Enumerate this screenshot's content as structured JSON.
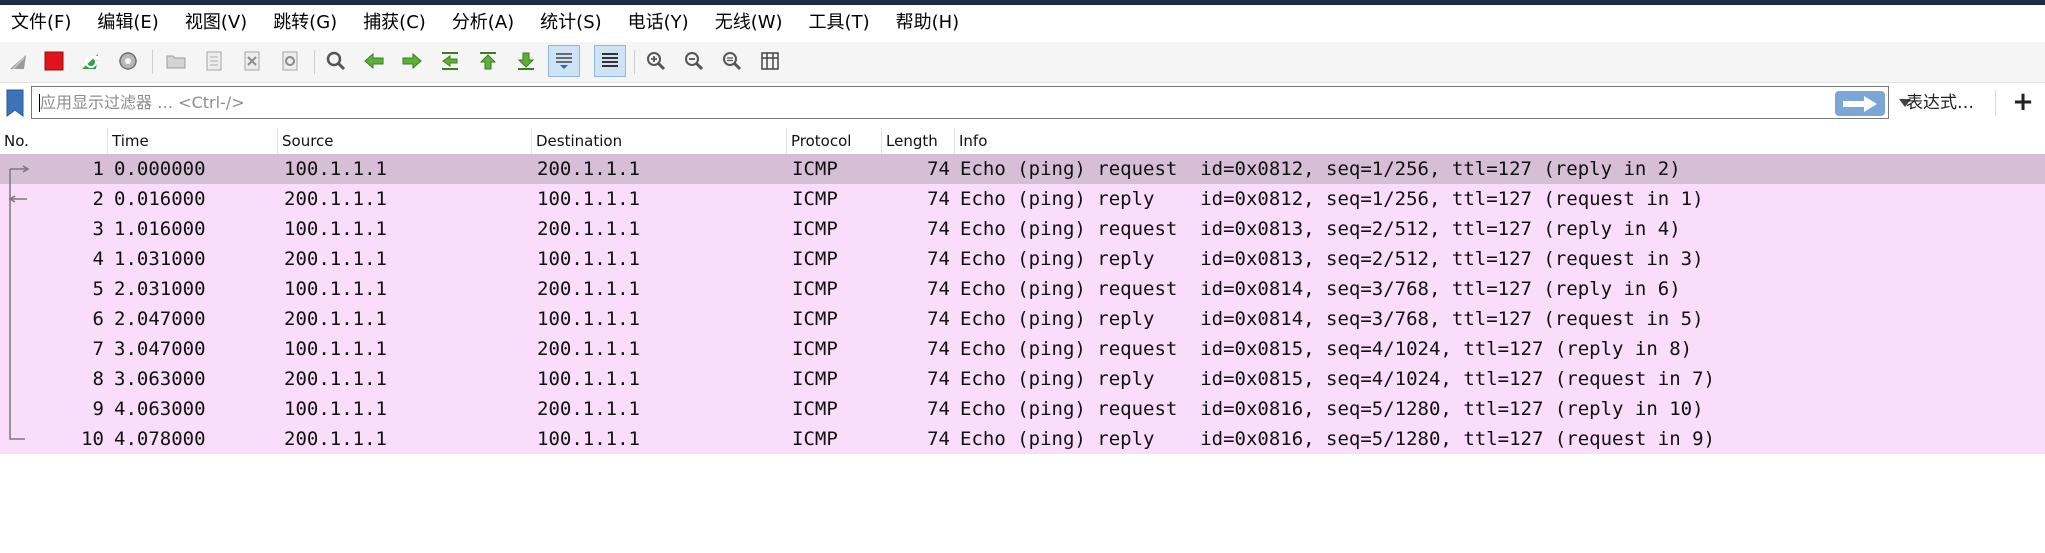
{
  "menu": [
    "文件(F)",
    "编辑(E)",
    "视图(V)",
    "跳转(G)",
    "捕获(C)",
    "分析(A)",
    "统计(S)",
    "电话(Y)",
    "无线(W)",
    "工具(T)",
    "帮助(H)"
  ],
  "toolbar": {
    "icons": [
      "shark-fin-start-icon",
      "stop-capture-icon",
      "restart-capture-icon",
      "capture-options-icon",
      "open-file-icon",
      "save-file-icon",
      "close-file-icon",
      "reload-file-icon",
      "find-packet-icon",
      "go-back-icon",
      "go-forward-icon",
      "go-to-packet-icon",
      "go-first-packet-icon",
      "go-last-packet-icon",
      "auto-scroll-icon",
      "colorize-icon",
      "zoom-in-icon",
      "zoom-out-icon",
      "normal-size-icon",
      "resize-columns-icon"
    ]
  },
  "filter": {
    "placeholder": "应用显示过滤器 … <Ctrl-/>",
    "value": "",
    "expression_label": "表达式…",
    "add_label": "+"
  },
  "packet_list": {
    "columns": [
      "No.",
      "Time",
      "Source",
      "Destination",
      "Protocol",
      "Length",
      "Info"
    ],
    "rows": [
      {
        "no": "1",
        "time": "0.000000",
        "source": "100.1.1.1",
        "destination": "200.1.1.1",
        "protocol": "ICMP",
        "length": "74",
        "info": "Echo (ping) request  id=0x0812, seq=1/256, ttl=127 (reply in 2)"
      },
      {
        "no": "2",
        "time": "0.016000",
        "source": "200.1.1.1",
        "destination": "100.1.1.1",
        "protocol": "ICMP",
        "length": "74",
        "info": "Echo (ping) reply    id=0x0812, seq=1/256, ttl=127 (request in 1)"
      },
      {
        "no": "3",
        "time": "1.016000",
        "source": "100.1.1.1",
        "destination": "200.1.1.1",
        "protocol": "ICMP",
        "length": "74",
        "info": "Echo (ping) request  id=0x0813, seq=2/512, ttl=127 (reply in 4)"
      },
      {
        "no": "4",
        "time": "1.031000",
        "source": "200.1.1.1",
        "destination": "100.1.1.1",
        "protocol": "ICMP",
        "length": "74",
        "info": "Echo (ping) reply    id=0x0813, seq=2/512, ttl=127 (request in 3)"
      },
      {
        "no": "5",
        "time": "2.031000",
        "source": "100.1.1.1",
        "destination": "200.1.1.1",
        "protocol": "ICMP",
        "length": "74",
        "info": "Echo (ping) request  id=0x0814, seq=3/768, ttl=127 (reply in 6)"
      },
      {
        "no": "6",
        "time": "2.047000",
        "source": "200.1.1.1",
        "destination": "100.1.1.1",
        "protocol": "ICMP",
        "length": "74",
        "info": "Echo (ping) reply    id=0x0814, seq=3/768, ttl=127 (request in 5)"
      },
      {
        "no": "7",
        "time": "3.047000",
        "source": "100.1.1.1",
        "destination": "200.1.1.1",
        "protocol": "ICMP",
        "length": "74",
        "info": "Echo (ping) request  id=0x0815, seq=4/1024, ttl=127 (reply in 8)"
      },
      {
        "no": "8",
        "time": "3.063000",
        "source": "200.1.1.1",
        "destination": "100.1.1.1",
        "protocol": "ICMP",
        "length": "74",
        "info": "Echo (ping) reply    id=0x0815, seq=4/1024, ttl=127 (request in 7)"
      },
      {
        "no": "9",
        "time": "4.063000",
        "source": "100.1.1.1",
        "destination": "200.1.1.1",
        "protocol": "ICMP",
        "length": "74",
        "info": "Echo (ping) request  id=0x0816, seq=5/1280, ttl=127 (reply in 10)"
      },
      {
        "no": "10",
        "time": "4.078000",
        "source": "200.1.1.1",
        "destination": "100.1.1.1",
        "protocol": "ICMP",
        "length": "74",
        "info": "Echo (ping) reply    id=0x0816, seq=5/1280, ttl=127 (request in 9)"
      }
    ],
    "selected_row": "1"
  },
  "colors": {
    "row_icmp": "#fadcfb",
    "row_selected": "#d6bed7",
    "apply_button": "#7aa7d6",
    "stop_button": "#e0141a",
    "top_strip": "#1e2a44"
  }
}
